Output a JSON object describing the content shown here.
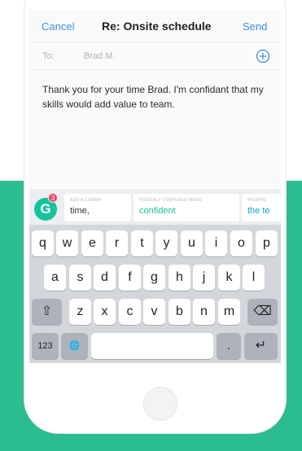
{
  "nav": {
    "cancel": "Cancel",
    "title": "Re: Onsite schedule",
    "send": "Send"
  },
  "to_row": {
    "label": "To:",
    "value": "Brad M."
  },
  "message": "Thank you for your time Brad. I'm confidant that my skills would add value to team.",
  "grammarly": {
    "badge_count": "3",
    "suggestions": [
      {
        "hint": "ADD A COMMA",
        "word": "time,"
      },
      {
        "hint": "POSSIBLY CONFUSED WORD",
        "word": "confident"
      },
      {
        "hint": "MISSING",
        "word": "the te"
      }
    ]
  },
  "keyboard": {
    "row1": [
      "q",
      "w",
      "e",
      "r",
      "t",
      "y",
      "u",
      "i",
      "o",
      "p"
    ],
    "row2": [
      "a",
      "s",
      "d",
      "f",
      "g",
      "h",
      "j",
      "k",
      "l"
    ],
    "row3": [
      "z",
      "x",
      "c",
      "v",
      "b",
      "n",
      "m"
    ],
    "numbers_key": "123",
    "period_key": ".",
    "shift_icon": "⇧",
    "backspace_icon": "⌫",
    "globe_icon": "🌐",
    "return_icon": "↵"
  },
  "colors": {
    "accent_green": "#2bbd8f",
    "link_blue": "#3a8fe0",
    "grammarly_green": "#15c39a",
    "badge_red": "#e84466"
  }
}
